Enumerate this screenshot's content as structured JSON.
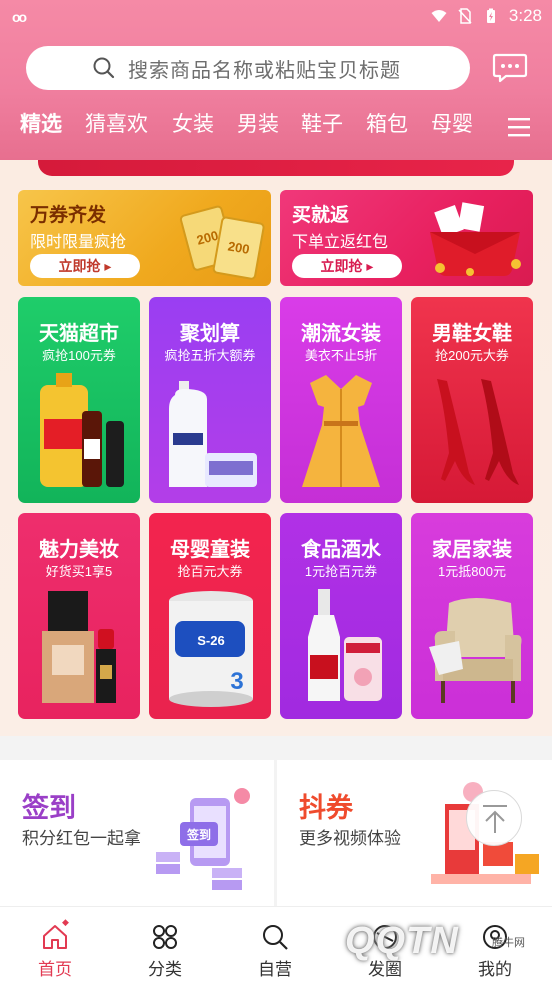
{
  "status_bar": {
    "left_glyph": "oo",
    "time": "3:28"
  },
  "search": {
    "placeholder": "搜索商品名称或粘贴宝贝标题"
  },
  "tabs": [
    "精选",
    "猜喜欢",
    "女装",
    "男装",
    "鞋子",
    "箱包",
    "母婴"
  ],
  "promos": [
    {
      "title": "万券齐发",
      "subtitle": "限时限量疯抢",
      "button": "立即抢"
    },
    {
      "title": "买就返",
      "subtitle": "下单立返红包",
      "button": "立即抢"
    }
  ],
  "categories": [
    {
      "title": "天猫超市",
      "subtitle": "疯抢100元券"
    },
    {
      "title": "聚划算",
      "subtitle": "疯抢五折大额券"
    },
    {
      "title": "潮流女装",
      "subtitle": "美衣不止5折"
    },
    {
      "title": "男鞋女鞋",
      "subtitle": "抢200元大券"
    },
    {
      "title": "魅力美妆",
      "subtitle": "好货买1享5"
    },
    {
      "title": "母婴童装",
      "subtitle": "抢百元大券"
    },
    {
      "title": "食品酒水",
      "subtitle": "1元抢百元券"
    },
    {
      "title": "家居家装",
      "subtitle": "1元抵800元"
    }
  ],
  "features": [
    {
      "title": "签到",
      "subtitle": "积分红包一起拿"
    },
    {
      "title": "抖券",
      "subtitle": "更多视频体验"
    }
  ],
  "bottom_nav": [
    {
      "label": "首页",
      "icon": "home-icon"
    },
    {
      "label": "分类",
      "icon": "category-icon"
    },
    {
      "label": "自营",
      "icon": "search-icon"
    },
    {
      "label": "发圈",
      "icon": "circle-icon"
    },
    {
      "label": "我的",
      "icon": "user-icon"
    }
  ],
  "watermark": {
    "text": "QQTN",
    "small": "腾牛网"
  },
  "colors": {
    "header": "#f07f9f",
    "accent": "#e23a52"
  }
}
